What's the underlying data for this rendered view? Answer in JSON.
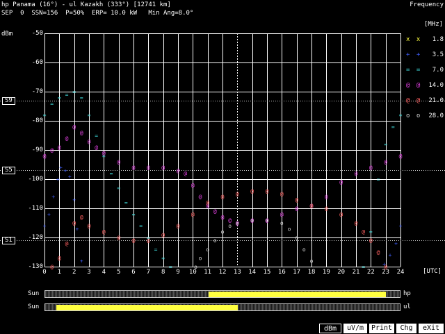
{
  "header": {
    "line1": "hp Panama (16°) - ul Kazakh (333°) [12741 km]",
    "line2": "SEP  0  SSN=156  P=50%  ERP= 10.0 kW   Min Ang=8.0°",
    "right_title": "Frequency"
  },
  "chart_data": {
    "type": "scatter",
    "title": "",
    "xlabel": "",
    "ylabel": "dBm",
    "x_unit_label": "[UTC]",
    "xlim": [
      0,
      24
    ],
    "ylim": [
      -130,
      -50
    ],
    "xticks": [
      "0",
      "1",
      "2",
      "3",
      "4",
      "5",
      "6",
      "7",
      "8",
      "9",
      "10",
      "11",
      "12",
      "13",
      "14",
      "15",
      "16",
      "17",
      "18",
      "19",
      "20",
      "21",
      "22",
      "23",
      "24"
    ],
    "yticks": [
      "-50",
      "-60",
      "-70",
      "-80",
      "-90",
      "-100",
      "-110",
      "-120",
      "-130"
    ],
    "current_time_marker": 13,
    "reference_lines": [
      {
        "label": "S9",
        "value": -73
      },
      {
        "label": "S5",
        "value": -97
      },
      {
        "label": "S1",
        "value": -121
      }
    ],
    "legend_header": "[MHz]",
    "series": [
      {
        "name": "1.8",
        "symbol": "x x",
        "color": "#ffff40",
        "x": [],
        "y": []
      },
      {
        "name": "3.5",
        "symbol": "+ +",
        "color": "#4060ff",
        "x": [
          0,
          0.3,
          0.6,
          0.9,
          1.1,
          1.4,
          1.7,
          2.0,
          2.2,
          2.5,
          22.9,
          23.3,
          23.7,
          24
        ],
        "y": [
          -116,
          -112,
          -106,
          -100,
          -96,
          -97,
          -99,
          -107,
          -117,
          -128,
          -129,
          -126,
          -122,
          -116
        ]
      },
      {
        "name": "7.0",
        "symbol": "= =",
        "color": "#40e0e0",
        "x": [
          0,
          0.5,
          1.0,
          1.5,
          2.0,
          2.5,
          3.0,
          3.5,
          4.0,
          4.5,
          5.0,
          5.5,
          6.0,
          6.5,
          7.0,
          7.5,
          8.0,
          8.5,
          21.5,
          22.0,
          22.5,
          23.0,
          23.5,
          24
        ],
        "y": [
          -78,
          -74,
          -72,
          -71,
          -70,
          -72,
          -78,
          -85,
          -92,
          -98,
          -103,
          -108,
          -112,
          -116,
          -120,
          -124,
          -127,
          -130,
          -130,
          -118,
          -100,
          -88,
          -82,
          -78
        ]
      },
      {
        "name": "14.0",
        "symbol": "@ @",
        "color": "#e040e0",
        "x": [
          0,
          0.5,
          1.0,
          1.5,
          2.0,
          2.5,
          3.0,
          3.5,
          4.0,
          5.0,
          6.0,
          7.0,
          8.0,
          9.0,
          9.5,
          10.0,
          10.5,
          11.0,
          11.5,
          12.0,
          12.5,
          13.0,
          14.0,
          15.0,
          16.0,
          17.0,
          18.0,
          19.0,
          20.0,
          21.0,
          22.0,
          23.0,
          24
        ],
        "y": [
          -92,
          -90,
          -89,
          -86,
          -82,
          -84,
          -87,
          -89,
          -91,
          -94,
          -96,
          -96,
          -96,
          -97,
          -98,
          -102,
          -106,
          -109,
          -111,
          -113,
          -114,
          -115,
          -114,
          -114,
          -112,
          -110,
          -109,
          -106,
          -101,
          -98,
          -96,
          -94,
          -92
        ]
      },
      {
        "name": "21.0",
        "symbol": "@ @",
        "color": "#ff6060",
        "x": [
          0.5,
          1.0,
          1.5,
          2.0,
          2.5,
          3.0,
          4.0,
          5.0,
          6.0,
          7.0,
          8.0,
          9.0,
          10.0,
          11.0,
          12.0,
          13.0,
          14.0,
          15.0,
          16.0,
          17.0,
          18.0,
          19.0,
          20.0,
          21.0,
          21.5,
          22.0,
          22.5,
          23.0
        ],
        "y": [
          -130,
          -127,
          -122,
          -115,
          -113,
          -116,
          -118,
          -120,
          -121,
          -121,
          -119,
          -116,
          -112,
          -108,
          -106,
          -105,
          -104,
          -104,
          -105,
          -107,
          -109,
          -110,
          -112,
          -115,
          -118,
          -121,
          -125,
          -130
        ]
      },
      {
        "name": "28.0",
        "symbol": "o o",
        "color": "#d8d8d8",
        "x": [
          10.2,
          10.5,
          11.0,
          11.5,
          12.0,
          12.5,
          13.0,
          14.0,
          15.0,
          16.0,
          16.5,
          17.0,
          17.5,
          18.0
        ],
        "y": [
          -130,
          -127,
          -124,
          -121,
          -118,
          -116,
          -115,
          -114,
          -114,
          -115,
          -117,
          -120,
          -124,
          -128
        ]
      }
    ]
  },
  "sunbars": [
    {
      "label": "Sun",
      "station": "hp",
      "fill_start_utc": 11,
      "fill_end_utc": 23
    },
    {
      "label": "Sun",
      "station": "ul",
      "fill_start_utc": 0.7,
      "fill_end_utc": 13
    }
  ],
  "toolbar": {
    "buttons": [
      {
        "label": "dBm",
        "active": true
      },
      {
        "label": "uV/m",
        "active": false
      },
      {
        "label": "Print",
        "active": false
      },
      {
        "label": "Chg",
        "active": false
      },
      {
        "label": "eXit",
        "active": false
      }
    ]
  }
}
